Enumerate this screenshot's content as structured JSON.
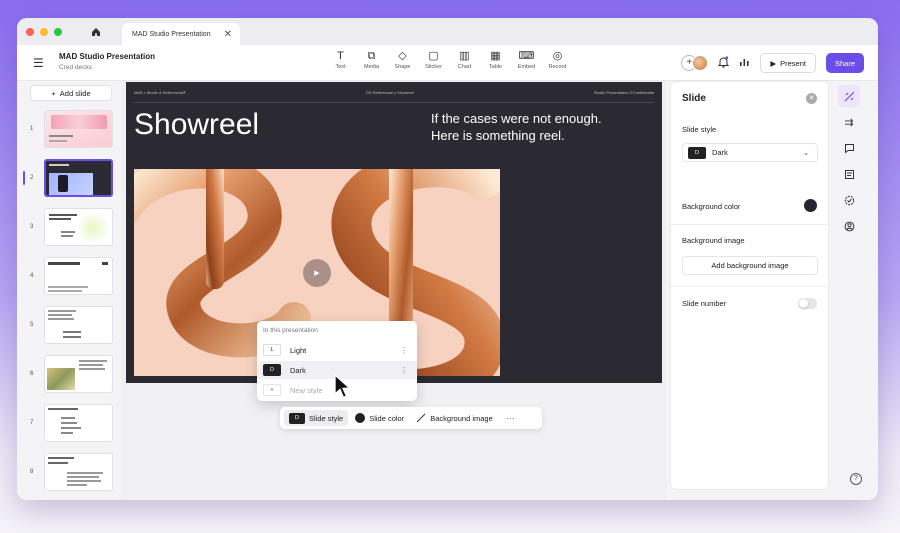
{
  "titlebar": {
    "window_dots": [
      "#ff5f57",
      "#febc2e",
      "#28c840"
    ],
    "home_icon": "home-icon",
    "tab_title": "MAD Studio Presentation",
    "tab_close": "✕"
  },
  "header": {
    "menu_icon": "hamburger-icon",
    "doc_title": "MAD Studio Presentation",
    "doc_subtitle": "Cred decks",
    "tools": [
      {
        "label": "Text",
        "icon": "T"
      },
      {
        "label": "Media",
        "icon": "⧉"
      },
      {
        "label": "Shape",
        "icon": "◇"
      },
      {
        "label": "Sticker",
        "icon": "▢"
      },
      {
        "label": "Chart",
        "icon": "▥"
      },
      {
        "label": "Table",
        "icon": "▦"
      },
      {
        "label": "Embed",
        "icon": "⌨"
      },
      {
        "label": "Record",
        "icon": "◎"
      }
    ],
    "add_collab": "+",
    "present_label": "Present",
    "share_label": "Share"
  },
  "sidebar": {
    "add_slide_label": "Add slide",
    "slide_numbers": [
      "1",
      "2",
      "3",
      "4",
      "5",
      "6",
      "7",
      "8"
    ]
  },
  "slide": {
    "topbar_left": "MAD • Studio & Referencial®",
    "topbar_mid": "DS Referencial y Showreel",
    "topbar_right": "Studio Presentation ©Confidential",
    "title": "Showreel",
    "reel_line1": "If the cases were not enough.",
    "reel_line2": "Here is something reel.",
    "play_icon": "▶"
  },
  "style_popover": {
    "heading": "In this presentation",
    "items": [
      {
        "label": "Light",
        "badge": "L"
      },
      {
        "label": "Dark",
        "badge": "D"
      },
      {
        "label": "New style",
        "badge": "+"
      }
    ]
  },
  "context_bar": {
    "slide_style": "Slide style",
    "slide_color": "Slide color",
    "background_image": "Background image",
    "more": "···"
  },
  "panel": {
    "title": "Slide",
    "slide_style_label": "Slide style",
    "slide_style_value": "Dark",
    "slide_style_badge": "D",
    "bg_color_label": "Background color",
    "bg_color_value": "#25252f",
    "bg_image_label": "Background image",
    "add_bg_image": "Add background image",
    "slide_number_label": "Slide number"
  },
  "colors": {
    "accent": "#6c4dea",
    "slide_bg": "#2b2a33",
    "hero_bg": "#f7d2c0"
  }
}
